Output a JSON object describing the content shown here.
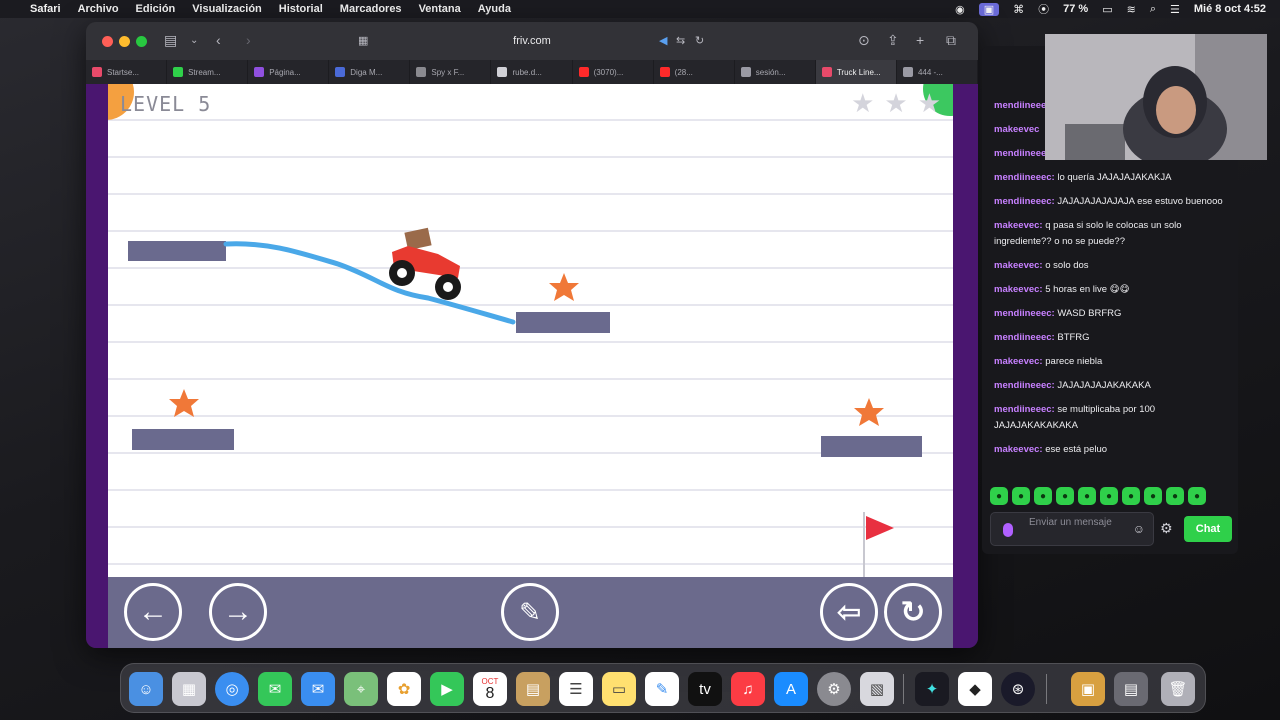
{
  "menubar": {
    "items": [
      "Safari",
      "Archivo",
      "Edición",
      "Visualización",
      "Historial",
      "Marcadores",
      "Ventana",
      "Ayuda"
    ],
    "battery": "77 %",
    "datetime": "Mié 8 oct 4:52"
  },
  "browser": {
    "url": "friv.com",
    "tabs": [
      "Startse...",
      "Stream...",
      "Página...",
      "Diga M...",
      "Spy x F...",
      "rube.d...",
      "(3070)...",
      "(28...",
      "sesión...",
      "Truck Line...",
      "444 -..."
    ],
    "active_tab_index": 9
  },
  "game": {
    "level_label": "LEVEL 5",
    "rating_stars": 3,
    "colors": {
      "platform": "#6a6a8e",
      "drawn_line": "#4aa8e8",
      "star": "#f07838",
      "flag": "#e83040",
      "controls_bg": "#6b6a8c"
    },
    "controls": {
      "left": "←",
      "right": "→",
      "eraser": "✎",
      "exit": "⇦",
      "restart": "↻"
    }
  },
  "chat": {
    "messages": [
      {
        "user": "mendiineeec",
        "text": ""
      },
      {
        "user": "makeevec",
        "text": ""
      },
      {
        "user": "mendiineeec",
        "text": ""
      },
      {
        "user": "mendiineeec:",
        "text": "lo quería JAJAJAJAKAKJA"
      },
      {
        "user": "mendiineeec:",
        "text": "JAJAJAJAJAJAJA ese estuvo buenooo"
      },
      {
        "user": "makeevec:",
        "text": "q pasa si solo le colocas un solo ingrediente?? o no se puede??"
      },
      {
        "user": "makeevec:",
        "text": "o solo dos"
      },
      {
        "user": "makeevec:",
        "text": "5 horas en live 😋😋"
      },
      {
        "user": "mendiineeec:",
        "text": "WASD BRFRG"
      },
      {
        "user": "mendiineeec:",
        "text": "BTFRG"
      },
      {
        "user": "makeevec:",
        "text": "parece niebla"
      },
      {
        "user": "mendiineeec:",
        "text": "JAJAJAJAJAKAKAKA"
      },
      {
        "user": "mendiineeec:",
        "text": "se multiplicaba por 100 JAJAJAKAKAKAKA"
      },
      {
        "user": "makeevec:",
        "text": "ese está peluo"
      }
    ],
    "input_placeholder": "Enviar un mensaje",
    "send_label": "Chat"
  },
  "dock": {
    "calendar_month": "OCT",
    "calendar_day": "8",
    "apps": [
      "Finder",
      "Launchpad",
      "Safari",
      "Messages",
      "Mail",
      "Maps",
      "Photos",
      "FaceTime",
      "Calendar",
      "Notes",
      "Reminders",
      "Notes2",
      "Freeform",
      "TV",
      "Music",
      "App Store",
      "System Settings",
      "Preview",
      "Game",
      "Roblox",
      "Steam",
      "Stuff",
      "Tools",
      "Trash"
    ]
  }
}
